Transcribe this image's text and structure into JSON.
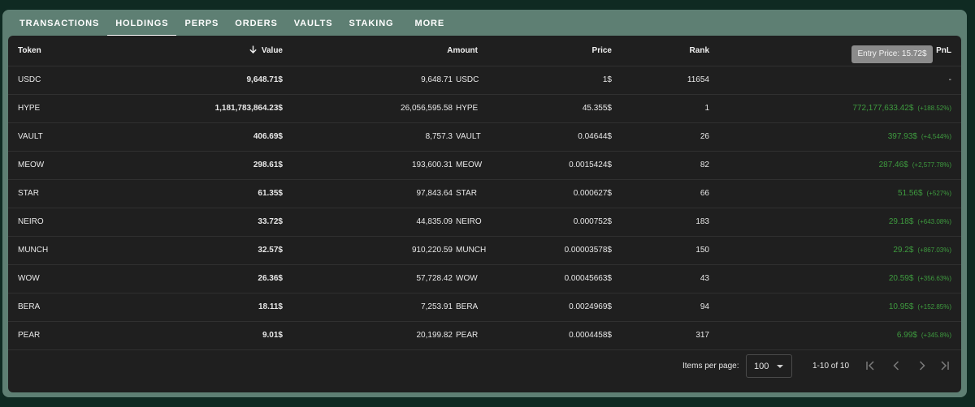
{
  "tabs": [
    {
      "label": "TRANSACTIONS"
    },
    {
      "label": "HOLDINGS"
    },
    {
      "label": "PERPS"
    },
    {
      "label": "ORDERS"
    },
    {
      "label": "VAULTS"
    },
    {
      "label": "STAKING"
    },
    {
      "label": "MORE"
    }
  ],
  "active_tab": "HOLDINGS",
  "table": {
    "headers": {
      "token": "Token",
      "value": "Value",
      "amount": "Amount",
      "price": "Price",
      "rank": "Rank",
      "pnl": "PnL"
    },
    "sort_icon": "arrow-down-icon",
    "rows": [
      {
        "token": "USDC",
        "value": "9,648.71$",
        "amount": "9,648.71",
        "symbol": "USDC",
        "price": "1$",
        "rank": "11654",
        "pnl": "-",
        "pnl_pct": ""
      },
      {
        "token": "HYPE",
        "value": "1,181,783,864.23$",
        "amount": "26,056,595.58",
        "symbol": "HYPE",
        "price": "45.355$",
        "rank": "1",
        "pnl": "772,177,633.42$",
        "pnl_pct": "(+188.52%)"
      },
      {
        "token": "VAULT",
        "value": "406.69$",
        "amount": "8,757.3",
        "symbol": "VAULT",
        "price": "0.04644$",
        "rank": "26",
        "pnl": "397.93$",
        "pnl_pct": "(+4,544%)"
      },
      {
        "token": "MEOW",
        "value": "298.61$",
        "amount": "193,600.31",
        "symbol": "MEOW",
        "price": "0.0015424$",
        "rank": "82",
        "pnl": "287.46$",
        "pnl_pct": "(+2,577.78%)"
      },
      {
        "token": "STAR",
        "value": "61.35$",
        "amount": "97,843.64",
        "symbol": "STAR",
        "price": "0.000627$",
        "rank": "66",
        "pnl": "51.56$",
        "pnl_pct": "(+527%)"
      },
      {
        "token": "NEIRO",
        "value": "33.72$",
        "amount": "44,835.09",
        "symbol": "NEIRO",
        "price": "0.000752$",
        "rank": "183",
        "pnl": "29.18$",
        "pnl_pct": "(+643.08%)"
      },
      {
        "token": "MUNCH",
        "value": "32.57$",
        "amount": "910,220.59",
        "symbol": "MUNCH",
        "price": "0.00003578$",
        "rank": "150",
        "pnl": "29.2$",
        "pnl_pct": "(+867.03%)"
      },
      {
        "token": "WOW",
        "value": "26.36$",
        "amount": "57,728.42",
        "symbol": "WOW",
        "price": "0.00045663$",
        "rank": "43",
        "pnl": "20.59$",
        "pnl_pct": "(+356.63%)"
      },
      {
        "token": "BERA",
        "value": "18.11$",
        "amount": "7,253.91",
        "symbol": "BERA",
        "price": "0.0024969$",
        "rank": "94",
        "pnl": "10.95$",
        "pnl_pct": "(+152.85%)"
      },
      {
        "token": "PEAR",
        "value": "9.01$",
        "amount": "20,199.82",
        "symbol": "PEAR",
        "price": "0.0004458$",
        "rank": "317",
        "pnl": "6.99$",
        "pnl_pct": "(+345.8%)"
      }
    ]
  },
  "tooltip": {
    "text": "Entry Price: 15.72$"
  },
  "pagination": {
    "items_per_page_label": "Items per page:",
    "items_per_page_value": "100",
    "range_label": "1-10 of 10",
    "icons": [
      "first-page-icon",
      "prev-page-icon",
      "next-page-icon",
      "last-page-icon"
    ]
  },
  "colors": {
    "frame": "#5e7f73",
    "panel": "#1f1f1f",
    "positive": "#3e9b3f"
  }
}
